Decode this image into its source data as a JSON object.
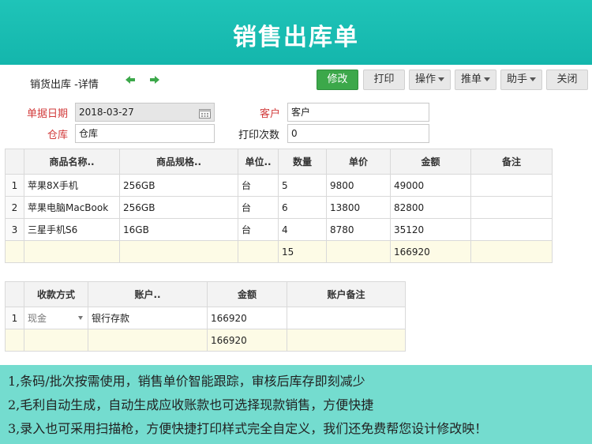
{
  "banner": {
    "title": "销售出库单"
  },
  "header": {
    "breadcrumb": "销货出库 -详情"
  },
  "toolbar": {
    "edit": "修改",
    "print": "打印",
    "operate": "操作",
    "push": "推单",
    "assistant": "助手",
    "close": "关闭"
  },
  "form": {
    "date_label": "单据日期",
    "date_value": "2018-03-27",
    "customer_label": "客户",
    "customer_value": "客户",
    "warehouse_label": "仓库",
    "warehouse_value": "仓库",
    "print_count_label": "打印次数",
    "print_count_value": "0"
  },
  "items_table": {
    "headers": [
      "商品名称..",
      "商品规格..",
      "单位..",
      "数量",
      "单价",
      "金额",
      "备注"
    ],
    "rows": [
      {
        "idx": "1",
        "name": "苹果8X手机",
        "spec": "256GB",
        "unit": "台",
        "qty": "5",
        "price": "9800",
        "amount": "49000",
        "note": ""
      },
      {
        "idx": "2",
        "name": "苹果电脑MacBook",
        "spec": "256GB",
        "unit": "台",
        "qty": "6",
        "price": "13800",
        "amount": "82800",
        "note": ""
      },
      {
        "idx": "3",
        "name": "三星手机S6",
        "spec": "16GB",
        "unit": "台",
        "qty": "4",
        "price": "8780",
        "amount": "35120",
        "note": ""
      }
    ],
    "total_qty": "15",
    "total_amount": "166920"
  },
  "payment_table": {
    "headers": [
      "收款方式",
      "账户..",
      "金额",
      "账户备注"
    ],
    "rows": [
      {
        "idx": "1",
        "method": "现金",
        "account": "银行存款",
        "amount": "166920",
        "note": ""
      }
    ],
    "total_amount": "166920"
  },
  "footer": {
    "lines": [
      "1,条码/批次按需使用，销售单价智能跟踪，审核后库存即刻减少",
      "2,毛利自动生成，自动生成应收账款也可选择现款销售，方便快捷",
      "3,录入也可采用扫描枪，方便快捷打印样式完全自定义，我们还免费帮您设计修改映！"
    ]
  }
}
